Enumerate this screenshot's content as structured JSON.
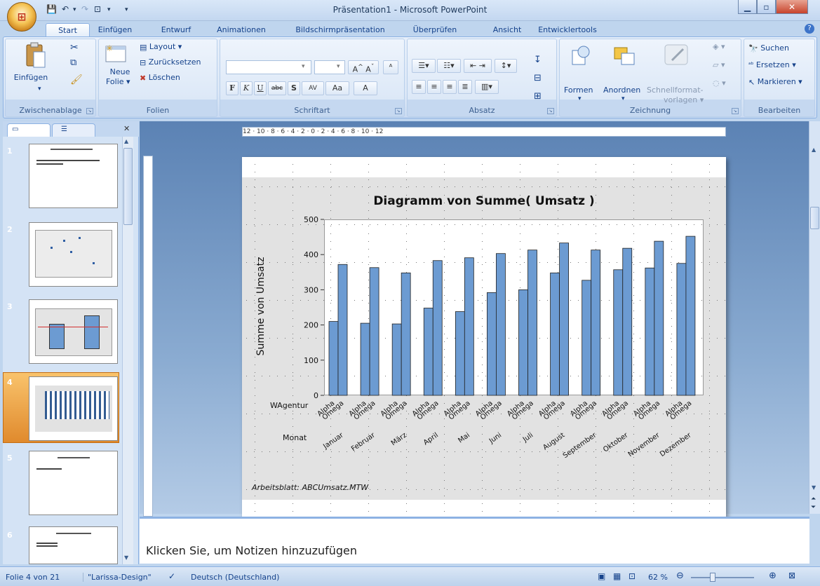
{
  "window": {
    "title": "Präsentation1 - Microsoft PowerPoint"
  },
  "tabs": [
    "Start",
    "Einfügen",
    "Entwurf",
    "Animationen",
    "Bildschirmpräsentation",
    "Überprüfen",
    "Ansicht",
    "Entwicklertools"
  ],
  "ribbon": {
    "clipboard": {
      "label": "Zwischenablage",
      "paste": "Einfügen"
    },
    "slides": {
      "label": "Folien",
      "new_slide_1": "Neue",
      "new_slide_2": "Folie",
      "layout": "Layout",
      "reset": "Zurücksetzen",
      "delete": "Löschen"
    },
    "font": {
      "label": "Schriftart",
      "bold": "F",
      "italic": "K",
      "underline": "U",
      "strike": "abc",
      "shadow": "S",
      "spacing": "AV",
      "case": "Aa",
      "color": "A"
    },
    "paragraph": {
      "label": "Absatz"
    },
    "drawing": {
      "label": "Zeichnung",
      "shapes": "Formen",
      "arrange": "Anordnen",
      "quickstyles_1": "Schnellformat-",
      "quickstyles_2": "vorlagen"
    },
    "editing": {
      "label": "Bearbeiten",
      "find": "Suchen",
      "replace": "Ersetzen",
      "select": "Markieren"
    }
  },
  "slide_numbers": [
    "1",
    "2",
    "3",
    "4",
    "5",
    "6"
  ],
  "chart_data": {
    "type": "bar",
    "title": "Diagramm von Summe( Umsatz )",
    "ylabel": "Summe von Umsatz",
    "xlabel_rows": [
      "WAgentur",
      "Monat"
    ],
    "categories": [
      "Januar",
      "Februar",
      "März",
      "April",
      "Mai",
      "Juni",
      "Juli",
      "August",
      "September",
      "Oktober",
      "November",
      "Dezember"
    ],
    "series": [
      {
        "name": "Alpha",
        "values": [
          210,
          205,
          203,
          248,
          238,
          292,
          300,
          348,
          327,
          357,
          362,
          375
        ]
      },
      {
        "name": "Omega",
        "values": [
          372,
          363,
          348,
          383,
          391,
          403,
          413,
          433,
          413,
          418,
          438,
          452
        ]
      }
    ],
    "ylim": [
      0,
      500
    ],
    "yticks": [
      "0",
      "100",
      "200",
      "300",
      "400",
      "500"
    ],
    "footnote": "Arbeitsblatt: ABCUmsatz.MTW",
    "bar_color": "#6c9bd2",
    "background_color": "#e2e2e2",
    "grid": false
  },
  "notes": {
    "placeholder": "Klicken Sie, um Notizen hinzuzufügen"
  },
  "status": {
    "slide": "Folie 4 von 21",
    "theme": "\"Larissa-Design\"",
    "language": "Deutsch (Deutschland)",
    "zoom": "62 %"
  },
  "ruler": {
    "horizontal": "12 · 10 · 8 · 6 · 4 · 2 · 0 · 2 · 4 · 6 · 8 · 10 · 12"
  }
}
